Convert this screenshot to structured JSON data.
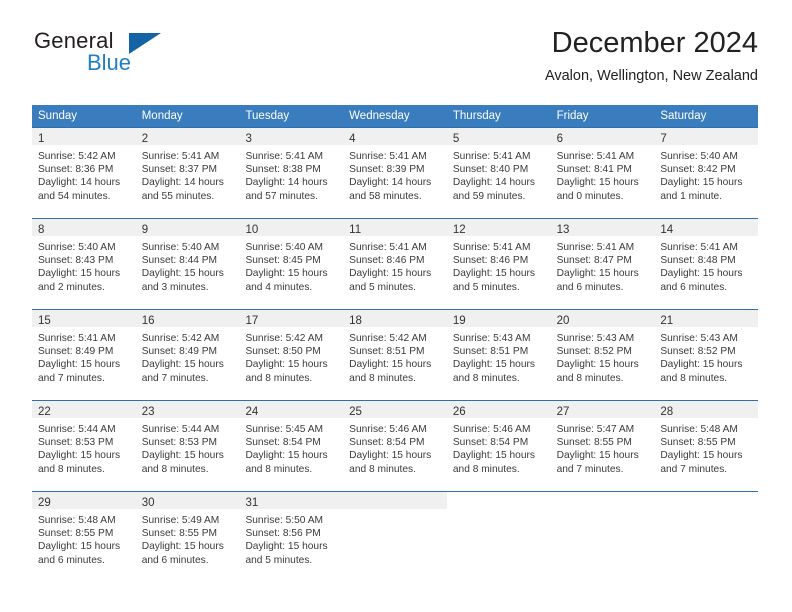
{
  "brand": {
    "word_one": "General",
    "word_two": "Blue",
    "flag_icon": "triangle-flag-icon"
  },
  "header": {
    "title": "December 2024",
    "subtitle": "Avalon, Wellington, New Zealand"
  },
  "colors": {
    "header_blue": "#3a7dbf",
    "row_divider_blue": "#2f6fae",
    "day_band_gray": "#f0f0f0",
    "brand_blue": "#1f7fc4",
    "flag_blue": "#1464a5"
  },
  "weekdays": [
    "Sunday",
    "Monday",
    "Tuesday",
    "Wednesday",
    "Thursday",
    "Friday",
    "Saturday"
  ],
  "weeks": [
    [
      {
        "day": "1",
        "sunrise": "Sunrise: 5:42 AM",
        "sunset": "Sunset: 8:36 PM",
        "daylight1": "Daylight: 14 hours",
        "daylight2": "and 54 minutes."
      },
      {
        "day": "2",
        "sunrise": "Sunrise: 5:41 AM",
        "sunset": "Sunset: 8:37 PM",
        "daylight1": "Daylight: 14 hours",
        "daylight2": "and 55 minutes."
      },
      {
        "day": "3",
        "sunrise": "Sunrise: 5:41 AM",
        "sunset": "Sunset: 8:38 PM",
        "daylight1": "Daylight: 14 hours",
        "daylight2": "and 57 minutes."
      },
      {
        "day": "4",
        "sunrise": "Sunrise: 5:41 AM",
        "sunset": "Sunset: 8:39 PM",
        "daylight1": "Daylight: 14 hours",
        "daylight2": "and 58 minutes."
      },
      {
        "day": "5",
        "sunrise": "Sunrise: 5:41 AM",
        "sunset": "Sunset: 8:40 PM",
        "daylight1": "Daylight: 14 hours",
        "daylight2": "and 59 minutes."
      },
      {
        "day": "6",
        "sunrise": "Sunrise: 5:41 AM",
        "sunset": "Sunset: 8:41 PM",
        "daylight1": "Daylight: 15 hours",
        "daylight2": "and 0 minutes."
      },
      {
        "day": "7",
        "sunrise": "Sunrise: 5:40 AM",
        "sunset": "Sunset: 8:42 PM",
        "daylight1": "Daylight: 15 hours",
        "daylight2": "and 1 minute."
      }
    ],
    [
      {
        "day": "8",
        "sunrise": "Sunrise: 5:40 AM",
        "sunset": "Sunset: 8:43 PM",
        "daylight1": "Daylight: 15 hours",
        "daylight2": "and 2 minutes."
      },
      {
        "day": "9",
        "sunrise": "Sunrise: 5:40 AM",
        "sunset": "Sunset: 8:44 PM",
        "daylight1": "Daylight: 15 hours",
        "daylight2": "and 3 minutes."
      },
      {
        "day": "10",
        "sunrise": "Sunrise: 5:40 AM",
        "sunset": "Sunset: 8:45 PM",
        "daylight1": "Daylight: 15 hours",
        "daylight2": "and 4 minutes."
      },
      {
        "day": "11",
        "sunrise": "Sunrise: 5:41 AM",
        "sunset": "Sunset: 8:46 PM",
        "daylight1": "Daylight: 15 hours",
        "daylight2": "and 5 minutes."
      },
      {
        "day": "12",
        "sunrise": "Sunrise: 5:41 AM",
        "sunset": "Sunset: 8:46 PM",
        "daylight1": "Daylight: 15 hours",
        "daylight2": "and 5 minutes."
      },
      {
        "day": "13",
        "sunrise": "Sunrise: 5:41 AM",
        "sunset": "Sunset: 8:47 PM",
        "daylight1": "Daylight: 15 hours",
        "daylight2": "and 6 minutes."
      },
      {
        "day": "14",
        "sunrise": "Sunrise: 5:41 AM",
        "sunset": "Sunset: 8:48 PM",
        "daylight1": "Daylight: 15 hours",
        "daylight2": "and 6 minutes."
      }
    ],
    [
      {
        "day": "15",
        "sunrise": "Sunrise: 5:41 AM",
        "sunset": "Sunset: 8:49 PM",
        "daylight1": "Daylight: 15 hours",
        "daylight2": "and 7 minutes."
      },
      {
        "day": "16",
        "sunrise": "Sunrise: 5:42 AM",
        "sunset": "Sunset: 8:49 PM",
        "daylight1": "Daylight: 15 hours",
        "daylight2": "and 7 minutes."
      },
      {
        "day": "17",
        "sunrise": "Sunrise: 5:42 AM",
        "sunset": "Sunset: 8:50 PM",
        "daylight1": "Daylight: 15 hours",
        "daylight2": "and 8 minutes."
      },
      {
        "day": "18",
        "sunrise": "Sunrise: 5:42 AM",
        "sunset": "Sunset: 8:51 PM",
        "daylight1": "Daylight: 15 hours",
        "daylight2": "and 8 minutes."
      },
      {
        "day": "19",
        "sunrise": "Sunrise: 5:43 AM",
        "sunset": "Sunset: 8:51 PM",
        "daylight1": "Daylight: 15 hours",
        "daylight2": "and 8 minutes."
      },
      {
        "day": "20",
        "sunrise": "Sunrise: 5:43 AM",
        "sunset": "Sunset: 8:52 PM",
        "daylight1": "Daylight: 15 hours",
        "daylight2": "and 8 minutes."
      },
      {
        "day": "21",
        "sunrise": "Sunrise: 5:43 AM",
        "sunset": "Sunset: 8:52 PM",
        "daylight1": "Daylight: 15 hours",
        "daylight2": "and 8 minutes."
      }
    ],
    [
      {
        "day": "22",
        "sunrise": "Sunrise: 5:44 AM",
        "sunset": "Sunset: 8:53 PM",
        "daylight1": "Daylight: 15 hours",
        "daylight2": "and 8 minutes."
      },
      {
        "day": "23",
        "sunrise": "Sunrise: 5:44 AM",
        "sunset": "Sunset: 8:53 PM",
        "daylight1": "Daylight: 15 hours",
        "daylight2": "and 8 minutes."
      },
      {
        "day": "24",
        "sunrise": "Sunrise: 5:45 AM",
        "sunset": "Sunset: 8:54 PM",
        "daylight1": "Daylight: 15 hours",
        "daylight2": "and 8 minutes."
      },
      {
        "day": "25",
        "sunrise": "Sunrise: 5:46 AM",
        "sunset": "Sunset: 8:54 PM",
        "daylight1": "Daylight: 15 hours",
        "daylight2": "and 8 minutes."
      },
      {
        "day": "26",
        "sunrise": "Sunrise: 5:46 AM",
        "sunset": "Sunset: 8:54 PM",
        "daylight1": "Daylight: 15 hours",
        "daylight2": "and 8 minutes."
      },
      {
        "day": "27",
        "sunrise": "Sunrise: 5:47 AM",
        "sunset": "Sunset: 8:55 PM",
        "daylight1": "Daylight: 15 hours",
        "daylight2": "and 7 minutes."
      },
      {
        "day": "28",
        "sunrise": "Sunrise: 5:48 AM",
        "sunset": "Sunset: 8:55 PM",
        "daylight1": "Daylight: 15 hours",
        "daylight2": "and 7 minutes."
      }
    ],
    [
      {
        "day": "29",
        "sunrise": "Sunrise: 5:48 AM",
        "sunset": "Sunset: 8:55 PM",
        "daylight1": "Daylight: 15 hours",
        "daylight2": "and 6 minutes."
      },
      {
        "day": "30",
        "sunrise": "Sunrise: 5:49 AM",
        "sunset": "Sunset: 8:55 PM",
        "daylight1": "Daylight: 15 hours",
        "daylight2": "and 6 minutes."
      },
      {
        "day": "31",
        "sunrise": "Sunrise: 5:50 AM",
        "sunset": "Sunset: 8:56 PM",
        "daylight1": "Daylight: 15 hours",
        "daylight2": "and 5 minutes."
      },
      {
        "day": "",
        "sunrise": "",
        "sunset": "",
        "daylight1": "",
        "daylight2": ""
      },
      {
        "day": "",
        "sunrise": "",
        "sunset": "",
        "daylight1": "",
        "daylight2": ""
      },
      {
        "day": "",
        "sunrise": "",
        "sunset": "",
        "daylight1": "",
        "daylight2": ""
      },
      {
        "day": "",
        "sunrise": "",
        "sunset": "",
        "daylight1": "",
        "daylight2": ""
      }
    ]
  ]
}
